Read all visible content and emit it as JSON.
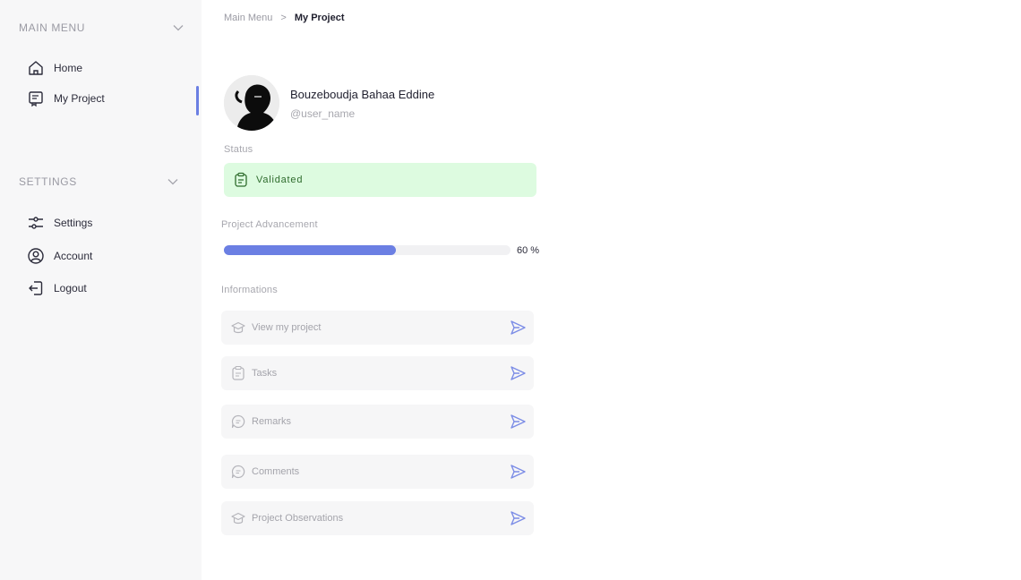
{
  "sidebar": {
    "main_menu": {
      "title": "MAIN MENU",
      "items": [
        {
          "label": "Home",
          "icon": "home-icon"
        },
        {
          "label": "My Project",
          "icon": "project-icon"
        }
      ]
    },
    "settings": {
      "title": "SETTINGS",
      "items": [
        {
          "label": "Settings",
          "icon": "sliders-icon"
        },
        {
          "label": "Account",
          "icon": "user-circle-icon"
        },
        {
          "label": "Logout",
          "icon": "logout-icon"
        }
      ]
    }
  },
  "breadcrumb": {
    "root": "Main Menu",
    "separator": ">",
    "current": "My Project"
  },
  "profile": {
    "name": "Bouzeboudja Bahaa Eddine",
    "handle": "@user_name"
  },
  "status": {
    "label": "Status",
    "value": "Validated",
    "color": "#ddfbe0"
  },
  "progress": {
    "label": "Project Advancement",
    "percent": 60,
    "text": "60 %",
    "color": "#6b7fe3"
  },
  "informations": {
    "label": "Informations",
    "items": [
      {
        "label": "View my project",
        "icon": "cap-icon"
      },
      {
        "label": "Tasks",
        "icon": "clipboard-icon"
      },
      {
        "label": "Remarks",
        "icon": "chat-icon"
      },
      {
        "label": "Comments",
        "icon": "chat-icon"
      },
      {
        "label": "Project Observations",
        "icon": "cap-icon"
      }
    ]
  }
}
